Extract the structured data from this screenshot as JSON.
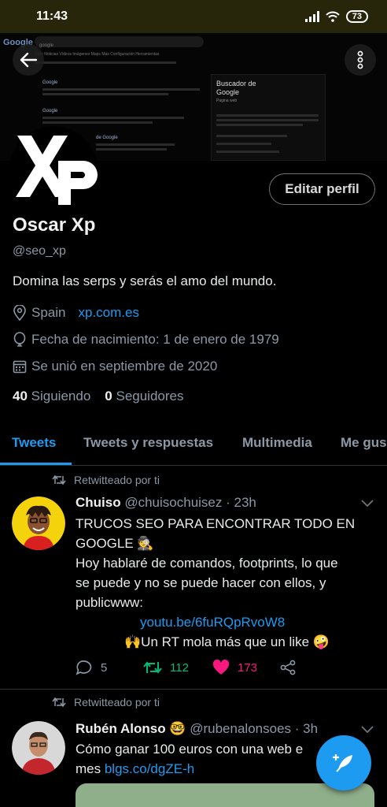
{
  "status_bar": {
    "time": "11:43",
    "battery": "73"
  },
  "banner": {
    "google_logo": "Google",
    "search_query": "google",
    "tabs_text": "Todo   Noticias   Vídeos   Imágenes   Maps   Más   Configuración   Herramientas",
    "result1_title": "Google",
    "result2_title": "Google",
    "result3_title": "de Google",
    "kp_title": "Buscador de Google",
    "kp_subtitle": "Página web"
  },
  "profile": {
    "edit_label": "Editar perfil",
    "name": "Oscar Xp",
    "handle": "@seo_xp",
    "bio": "Domina las serps y serás el amo del mundo.",
    "location": "Spain",
    "website": "xp.com.es",
    "birthdate": "Fecha de nacimiento: 1 de enero de 1979",
    "joined": "Se unió en septiembre de 2020",
    "following_count": "40",
    "following_label": "Siguiendo",
    "followers_count": "0",
    "followers_label": "Seguidores"
  },
  "tabs": [
    {
      "label": "Tweets"
    },
    {
      "label": "Tweets y respuestas"
    },
    {
      "label": "Multimedia"
    },
    {
      "label": "Me gus"
    }
  ],
  "tweets": [
    {
      "retweet_label": "Retwitteado por ti",
      "author": "Chuiso",
      "meta": "@chuisochuisez · 23h",
      "line1": "TRUCOS SEO PARA ENCONTRAR TODO EN",
      "line2": "GOOGLE 🕵",
      "line3": "Hoy hablaré de comandos, footprints, lo que",
      "line4": "se puede y no se puede hacer con ellos, y",
      "line5": "publicwww:",
      "link": "youtu.be/6fuRQpRvoW8",
      "line6": "🙌Un RT mola más que un like 🤪",
      "replies": "5",
      "retweets": "112",
      "likes": "173"
    },
    {
      "retweet_label": "Retwitteado por ti",
      "author": "Rubén Alonso",
      "author_emoji": "🤓",
      "meta": "@rubenalonsoes · 3h",
      "line1": "Cómo ganar 100 euros con una web e",
      "line2_prefix": "mes ",
      "link": "blgs.co/dgZE-h"
    }
  ],
  "colors": {
    "accent": "#1d9bf0",
    "retweet": "#00ba7c",
    "like": "#f91880",
    "status_bar": "#27260a"
  }
}
